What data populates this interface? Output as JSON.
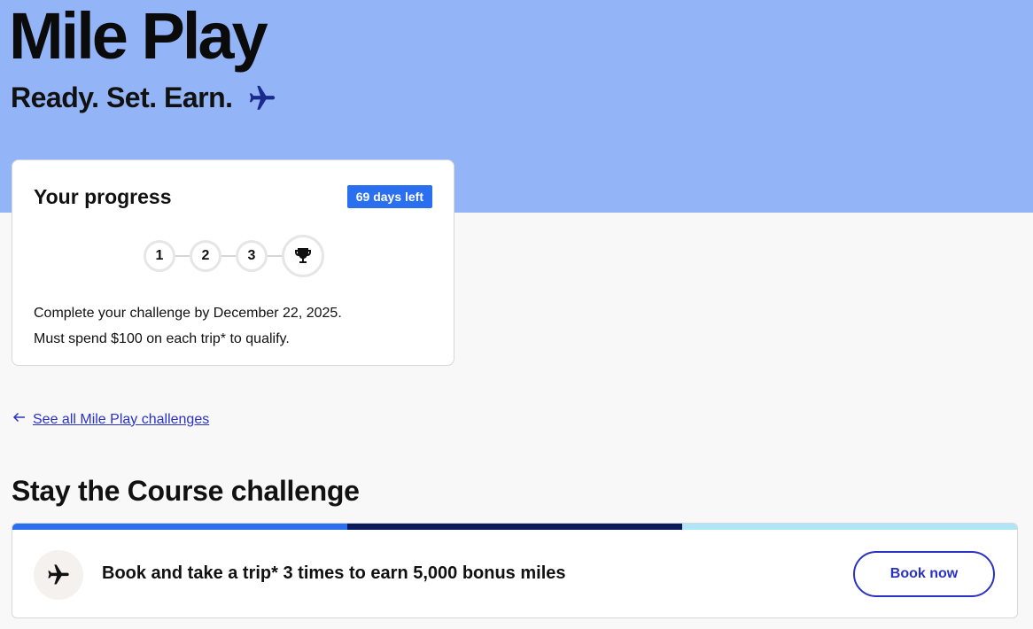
{
  "hero": {
    "title": "Mile Play",
    "tagline": "Ready. Set. Earn.",
    "tagline_icon": "airplane-icon",
    "background": "#93b4f7"
  },
  "progress": {
    "title": "Your progress",
    "days_left": "69 days left",
    "steps": [
      "1",
      "2",
      "3"
    ],
    "final_step_icon": "trophy-icon",
    "line1": "Complete your challenge by December 22, 2025.",
    "line2": "Must spend $100 on each trip* to qualify.",
    "badge_color": "#2a6ff0"
  },
  "nav": {
    "back_link": "See all Mile Play challenges",
    "back_icon": "arrow-left-icon",
    "link_color": "#2a32c4"
  },
  "challenge": {
    "heading": "Stay the Course challenge",
    "segment_colors": [
      "#2a6ff0",
      "#0a1a5c",
      "#aee6f8"
    ],
    "icon": "airplane-icon",
    "text": "Book and take a trip* 3 times to earn 5,000 bonus miles",
    "button": "Book now"
  }
}
